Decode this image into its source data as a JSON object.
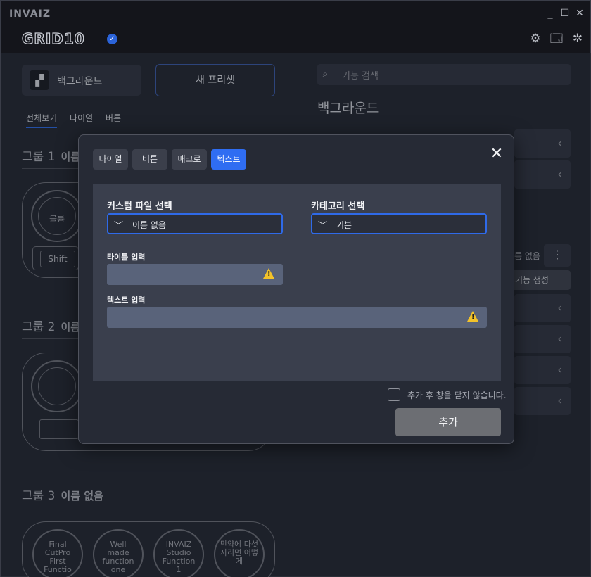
{
  "app": {
    "brand": "INVAIZ",
    "logo": "GRID10",
    "window_controls": {
      "minimize": "_",
      "maximize": "☐",
      "close": "✕"
    }
  },
  "header_icons": [
    "gear-icon",
    "save-icon",
    "settings-icon"
  ],
  "left": {
    "preset_label": "백그라운드",
    "new_preset_label": "새 프리셋",
    "view_tabs": [
      "전체보기",
      "다이얼",
      "버튼"
    ],
    "groups": [
      {
        "title": "그룹 1",
        "name": "이름"
      },
      {
        "title": "그룹 2",
        "name": "이름"
      },
      {
        "title": "그룹 3",
        "name": "이름 없음"
      }
    ],
    "group1": {
      "knob_label": "볼륨",
      "key_label": "Shift"
    },
    "group3_dials": [
      "Final CutPro First Functio",
      "Well made function one",
      "INVAIZ Studio Function 1",
      "만약에 다섯 자리면 어떻게"
    ]
  },
  "right": {
    "search_placeholder": "기능 검색",
    "title": "백그라운드",
    "partial_name": "름 없음",
    "kebab": "⋮",
    "func_create": "기능 생성",
    "chevron": "‹"
  },
  "modal": {
    "tabs": [
      {
        "label": "다이얼",
        "active": false
      },
      {
        "label": "버튼",
        "active": false
      },
      {
        "label": "매크로",
        "active": false
      },
      {
        "label": "텍스트",
        "active": true
      }
    ],
    "close": "✕",
    "custom_file_label": "커스텀 파일 선택",
    "custom_file_value": "이름 없음",
    "category_label": "카테고리 선택",
    "category_value": "기본",
    "title_input_label": "타이틀 입력",
    "text_input_label": "텍스트 입력",
    "keep_open_label": "추가 후 창을 닫지 않습니다.",
    "add_button": "추가",
    "accent": "#2f6df2",
    "warning_color": "#f2c22a"
  }
}
